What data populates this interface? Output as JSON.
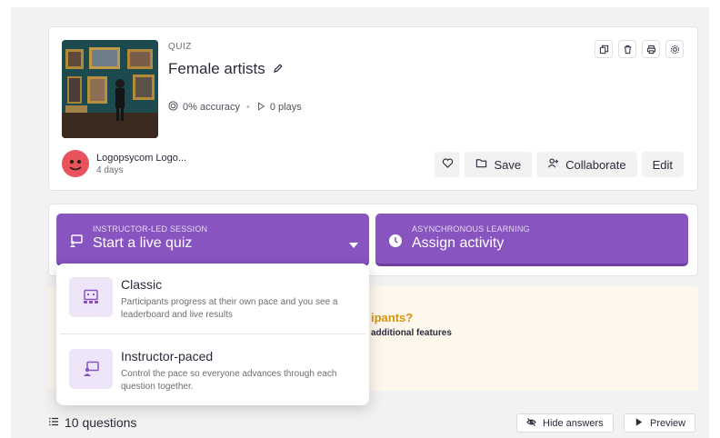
{
  "quiz": {
    "type_label": "QUIZ",
    "title": "Female artists",
    "accuracy": "0% accuracy",
    "plays": "0 plays",
    "author_name": "Logopsycom Logo...",
    "author_time": "4 days"
  },
  "actions": {
    "save": "Save",
    "collaborate": "Collaborate",
    "edit": "Edit"
  },
  "session": {
    "live_label": "INSTRUCTOR-LED SESSION",
    "live_text": "Start a live quiz",
    "async_label": "ASYNCHRONOUS LEARNING",
    "async_text": "Assign activity"
  },
  "dropdown": {
    "items": [
      {
        "title": "Classic",
        "desc": "Participants progress at their own pace and you see a leaderboard and live results"
      },
      {
        "title": "Instructor-paced",
        "desc": "Control the pace so everyone advances through each question together."
      }
    ]
  },
  "upsell": {
    "title_fragment": "ipants?",
    "sub_fragment": "additional features"
  },
  "footer": {
    "question_count": "10 questions",
    "hide_answers": "Hide answers",
    "preview": "Preview"
  },
  "colors": {
    "brand_purple": "#8854c0",
    "upsell_bg": "#fdf7ec",
    "upsell_accent": "#d9930d",
    "avatar": "#e8525a"
  },
  "icons": {
    "title_edit": "pencil-icon",
    "accuracy": "target-icon",
    "plays": "play-outline-icon",
    "toolbar": [
      "duplicate-icon",
      "trash-icon",
      "print-icon",
      "settings-icon"
    ],
    "like": "heart-icon",
    "save": "folder-icon",
    "collaborate": "add-user-icon",
    "live": "presentation-icon",
    "async": "clock-icon",
    "questions": "list-icon",
    "hide_answers": "eye-off-icon",
    "preview": "play-icon"
  }
}
